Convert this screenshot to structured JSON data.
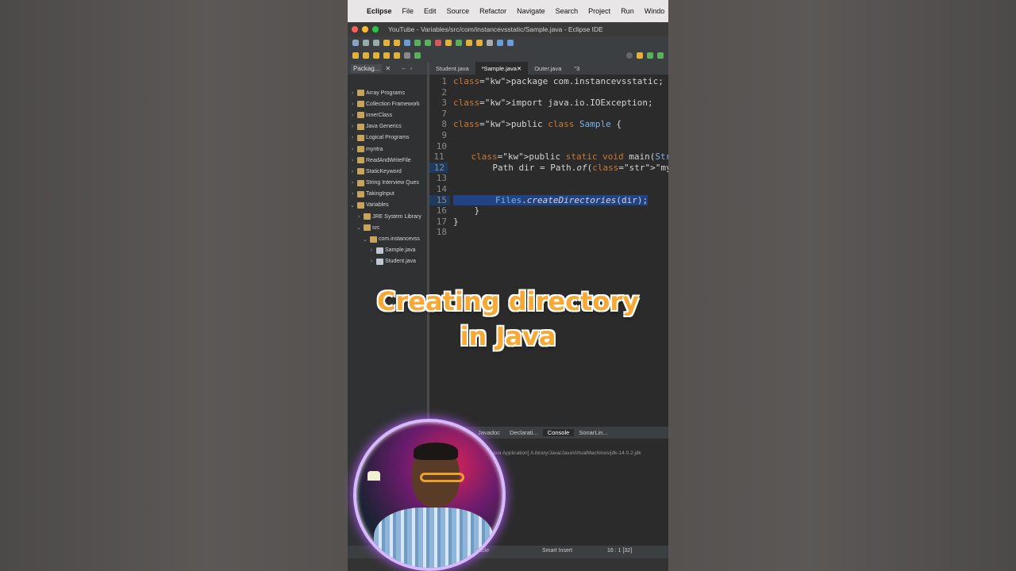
{
  "menubar": {
    "items": [
      "Eclipse",
      "File",
      "Edit",
      "Source",
      "Refactor",
      "Navigate",
      "Search",
      "Project",
      "Run",
      "Windo"
    ]
  },
  "window": {
    "title": "YouTube - Variables/src/com/instancevsstatic/Sample.java - Eclipse IDE"
  },
  "package_explorer": {
    "tab_label": "Packag...",
    "items": [
      {
        "label": "Array Programs",
        "level": 0
      },
      {
        "label": "Collection Framework",
        "level": 0
      },
      {
        "label": "innerClass",
        "level": 0
      },
      {
        "label": "Java Generics",
        "level": 0
      },
      {
        "label": "Logical Programs",
        "level": 0
      },
      {
        "label": "myntra",
        "level": 0
      },
      {
        "label": "ReadAndWriteFile",
        "level": 0
      },
      {
        "label": "StaticKeyword",
        "level": 0
      },
      {
        "label": "String Interview Ques",
        "level": 0
      },
      {
        "label": "TakingInput",
        "level": 0
      },
      {
        "label": "Variables",
        "level": 0
      },
      {
        "label": "JRE System Library",
        "level": 1
      },
      {
        "label": "src",
        "level": 1
      },
      {
        "label": "com.instancevss",
        "level": 2
      },
      {
        "label": "Sample.java",
        "level": 3
      },
      {
        "label": "Student.java",
        "level": 3
      }
    ]
  },
  "editor": {
    "tabs": [
      "Student.java",
      "*Sample.java",
      "Outer.java",
      "\"3"
    ],
    "active_tab": 1,
    "lines": [
      {
        "n": "1",
        "text": "package com.instancevsstatic;"
      },
      {
        "n": "2",
        "text": ""
      },
      {
        "n": "3",
        "text": "import java.io.IOException;"
      },
      {
        "n": "7",
        "text": ""
      },
      {
        "n": "8",
        "text": "public class Sample {"
      },
      {
        "n": "9",
        "text": ""
      },
      {
        "n": "10",
        "text": ""
      },
      {
        "n": "11",
        "text": "    public static void main(String[] a"
      },
      {
        "n": "12",
        "text": "        Path dir = Path.of(\"mydir\");"
      },
      {
        "n": "13",
        "text": ""
      },
      {
        "n": "14",
        "text": ""
      },
      {
        "n": "15",
        "text": "        Files.createDirectories(dir);"
      },
      {
        "n": "16",
        "text": "    }"
      },
      {
        "n": "17",
        "text": "}"
      },
      {
        "n": "18",
        "text": ""
      }
    ]
  },
  "console": {
    "tabs": [
      "Javadoc",
      "Declarati...",
      "Console",
      "SonarLin..."
    ],
    "active_tab": 2,
    "path": "ava Application] /Library/Java/JavaVirtualMachines/jdk-14.0.2.jdk"
  },
  "status_bar": {
    "writable": "table",
    "insert_mode": "Smart Insert",
    "position": "16 : 1 [32]"
  },
  "overlay": {
    "line1": "Creating directory",
    "line2": "in Java"
  },
  "colors": {
    "caption": "#f7a933",
    "webcam_ring": "#b45cff",
    "selection": "#214283"
  }
}
